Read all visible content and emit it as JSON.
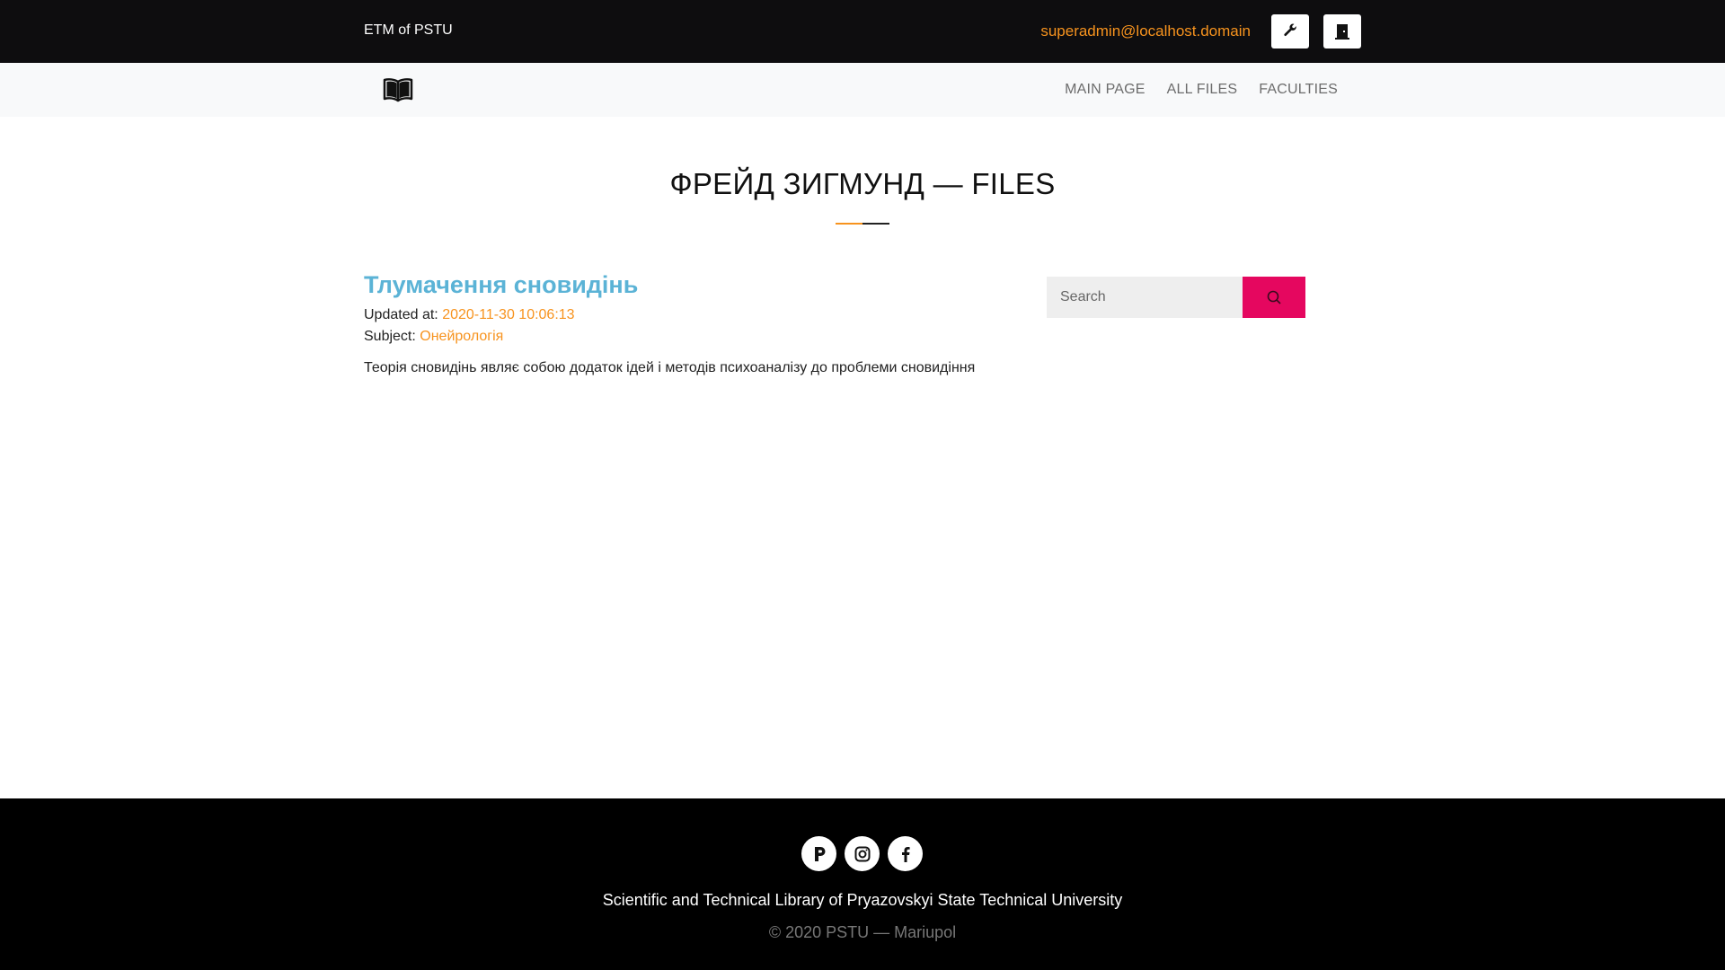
{
  "header": {
    "brand": "ETM of PSTU",
    "user_email": "superadmin@localhost.domain",
    "admin_icon": "wrench-icon",
    "logout_icon": "door-icon"
  },
  "nav": {
    "logo_icon": "open-book-icon",
    "links": [
      "MAIN PAGE",
      "ALL FILES",
      "FACULTIES"
    ]
  },
  "page": {
    "title": "ФРЕЙД ЗИГМУНД — FILES"
  },
  "file": {
    "title": "Тлумачення сновидінь",
    "updated_label": "Updated at:",
    "updated_value": "2020-11-30 10:06:13",
    "subject_label": "Subject:",
    "subject_value": "Онейрологія",
    "description": "Теорія сновидінь являє собою додаток ідей і методів психоаналізу до проблеми сновидіння"
  },
  "search": {
    "placeholder": "Search",
    "button_icon": "search-icon"
  },
  "footer": {
    "social_icons": [
      "p-logo-icon",
      "instagram-icon",
      "facebook-icon"
    ],
    "name": "Scientific and Technical Library of Pryazovskyi State Technical University",
    "copyright": "© 2020 PSTU — Mariupol"
  },
  "colors": {
    "accent_orange": "#f7931e",
    "link_blue": "#5bb3d6",
    "search_button": "#e5075f",
    "topbar": "#0e0d0f"
  }
}
